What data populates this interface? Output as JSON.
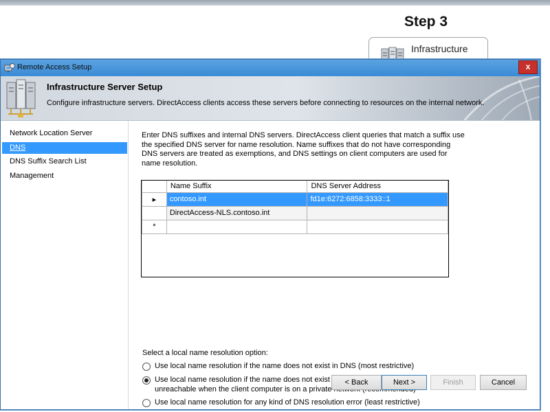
{
  "background": {
    "step_label": "Step 3",
    "tile_label": "Infrastructure",
    "tile_icon": "server-stack-icon"
  },
  "dialog": {
    "title": "Remote Access Setup",
    "close_glyph": "x",
    "header": {
      "title": "Infrastructure Server Setup",
      "description": "Configure infrastructure servers. DirectAccess clients access these servers before connecting to resources on the internal network."
    },
    "nav": [
      {
        "label": "Network Location Server",
        "selected": false
      },
      {
        "label": "DNS",
        "selected": true
      },
      {
        "label": "DNS Suffix Search List",
        "selected": false
      },
      {
        "label": "Management",
        "selected": false
      }
    ],
    "intro": "Enter DNS suffixes and internal DNS servers.  DirectAccess client queries that match a suffix use the specified DNS server for name resolution. Name suffixes that do not have corresponding DNS servers are treated as exemptions, and DNS settings on client computers are used for name resolution.",
    "grid": {
      "columns": [
        "Name Suffix",
        "DNS Server Address"
      ],
      "rows": [
        {
          "marker": "▸",
          "name_suffix": "contoso.int",
          "dns_server": "fd1e:6272:6858:3333::1"
        },
        {
          "marker": "",
          "name_suffix": "DirectAccess-NLS.contoso.int",
          "dns_server": ""
        },
        {
          "marker": "*",
          "name_suffix": "",
          "dns_server": ""
        }
      ]
    },
    "resolution_label": "Select a local name resolution option:",
    "options": [
      {
        "text": "Use local name resolution if the name does not exist in DNS (most restrictive)",
        "checked": false
      },
      {
        "text": "Use local name resolution if the name does not exist in DNS or DNS servers are unreachable when the client computer is on a private network (recommended)",
        "checked": true
      },
      {
        "text": "Use local name resolution for any kind of DNS resolution error (least restrictive)",
        "checked": false
      }
    ],
    "buttons": {
      "back": "< Back",
      "next": "Next >",
      "finish": "Finish",
      "cancel": "Cancel"
    }
  }
}
